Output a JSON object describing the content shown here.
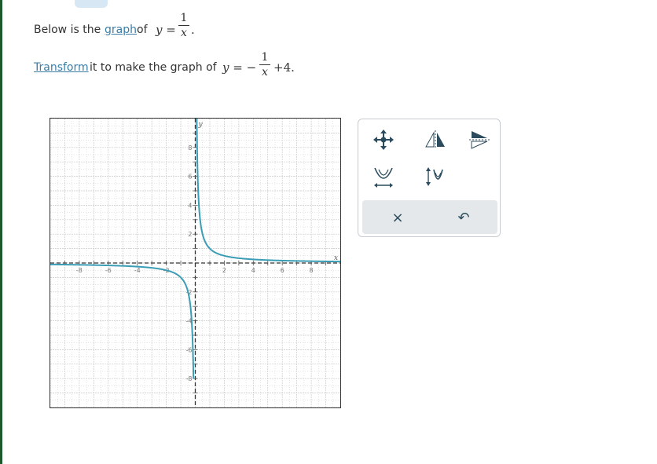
{
  "instruction": {
    "line1": {
      "prefix": "Below is the ",
      "link": "graph",
      "middle": " of ",
      "eq_lhs": "y =",
      "frac_num": "1",
      "frac_den": "x",
      "suffix": "."
    },
    "line2": {
      "link": "Transform",
      "middle": " it to make the graph of ",
      "eq_lhs": "y = −",
      "frac_num": "1",
      "frac_den": "x",
      "suffix": "+4."
    }
  },
  "graph": {
    "x_axis_label": "x",
    "y_axis_label": "y",
    "x_ticks": [
      "-8",
      "-6",
      "-4",
      "-2",
      "2",
      "4",
      "6",
      "8"
    ],
    "y_ticks": [
      "8",
      "6",
      "4",
      "2",
      "-2",
      "-4",
      "-6",
      "-8"
    ],
    "curve_color": "#3a9db5",
    "asymptote_color": "#333333",
    "grid_color": "#c9c9c9"
  },
  "chart_data": {
    "type": "line",
    "title": "",
    "xlabel": "x",
    "ylabel": "y",
    "xlim": [
      -10,
      10
    ],
    "ylim": [
      -10,
      10
    ],
    "grid": true,
    "series": [
      {
        "function": "y = 1/x",
        "asymptotes": {
          "vertical": 0,
          "horizontal": 0
        }
      }
    ]
  },
  "toolbox": {
    "tools": [
      "move-tool-icon",
      "reflect-horizontal-icon",
      "reflect-vertical-icon",
      "dilate-horizontal-icon",
      "dilate-vertical-icon"
    ],
    "clear_label": "×",
    "undo_label": "↶",
    "accent_color": "#2c4b5c"
  }
}
